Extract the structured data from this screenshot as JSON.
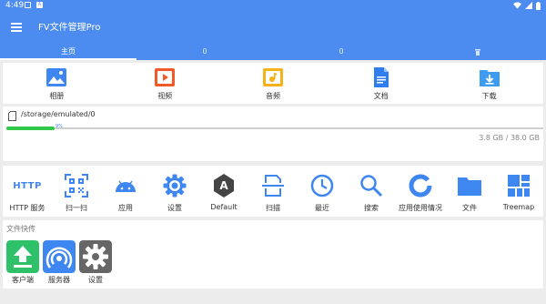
{
  "status_bar": {
    "time": "4:49",
    "notif_badge": "A"
  },
  "app_bar": {
    "title": "FV文件管理Pro",
    "menu_icon": "hamburger-menu-icon"
  },
  "tabs": [
    {
      "label": "主页",
      "active": true
    },
    {
      "label": "0",
      "active": false
    },
    {
      "label": "0",
      "active": false
    },
    {
      "label": "",
      "active": false
    }
  ],
  "categories": [
    {
      "label": "相册",
      "icon": "photo-album-icon"
    },
    {
      "label": "视频",
      "icon": "video-icon"
    },
    {
      "label": "音频",
      "icon": "audio-icon"
    },
    {
      "label": "文档",
      "icon": "document-icon"
    },
    {
      "label": "下载",
      "icon": "download-folder-icon"
    }
  ],
  "storage": {
    "path": "/storage/emulated/0",
    "percent_label": "9%",
    "usage_fraction": 0.09,
    "size_label": "3.8 GB  /  38.0 GB"
  },
  "tools": [
    {
      "label": "HTTP 服务",
      "icon": "http-icon",
      "icon_text": "HTTP"
    },
    {
      "label": "扫一扫",
      "icon": "qr-scan-icon"
    },
    {
      "label": "应用",
      "icon": "android-icon"
    },
    {
      "label": "设置",
      "icon": "settings-gear-icon"
    },
    {
      "label": "Default",
      "icon": "theme-a-icon",
      "icon_text": "A"
    },
    {
      "label": "扫描",
      "icon": "document-scan-icon"
    },
    {
      "label": "最近",
      "icon": "clock-icon"
    },
    {
      "label": "搜索",
      "icon": "search-icon"
    },
    {
      "label": "应用使用情况",
      "icon": "app-usage-donut-icon"
    },
    {
      "label": "文件",
      "icon": "folder-icon"
    },
    {
      "label": "Treemap",
      "icon": "treemap-icon"
    }
  ],
  "quick_transfer": {
    "title": "文件快传",
    "items": [
      {
        "label": "客户端",
        "icon": "client-upload-icon"
      },
      {
        "label": "服务器",
        "icon": "server-broadcast-icon"
      },
      {
        "label": "设置",
        "icon": "transfer-settings-icon"
      }
    ]
  },
  "colors": {
    "primary": "#4c8cf0",
    "icon_blue": "#3e86f0",
    "progress": "#2fc84a"
  }
}
